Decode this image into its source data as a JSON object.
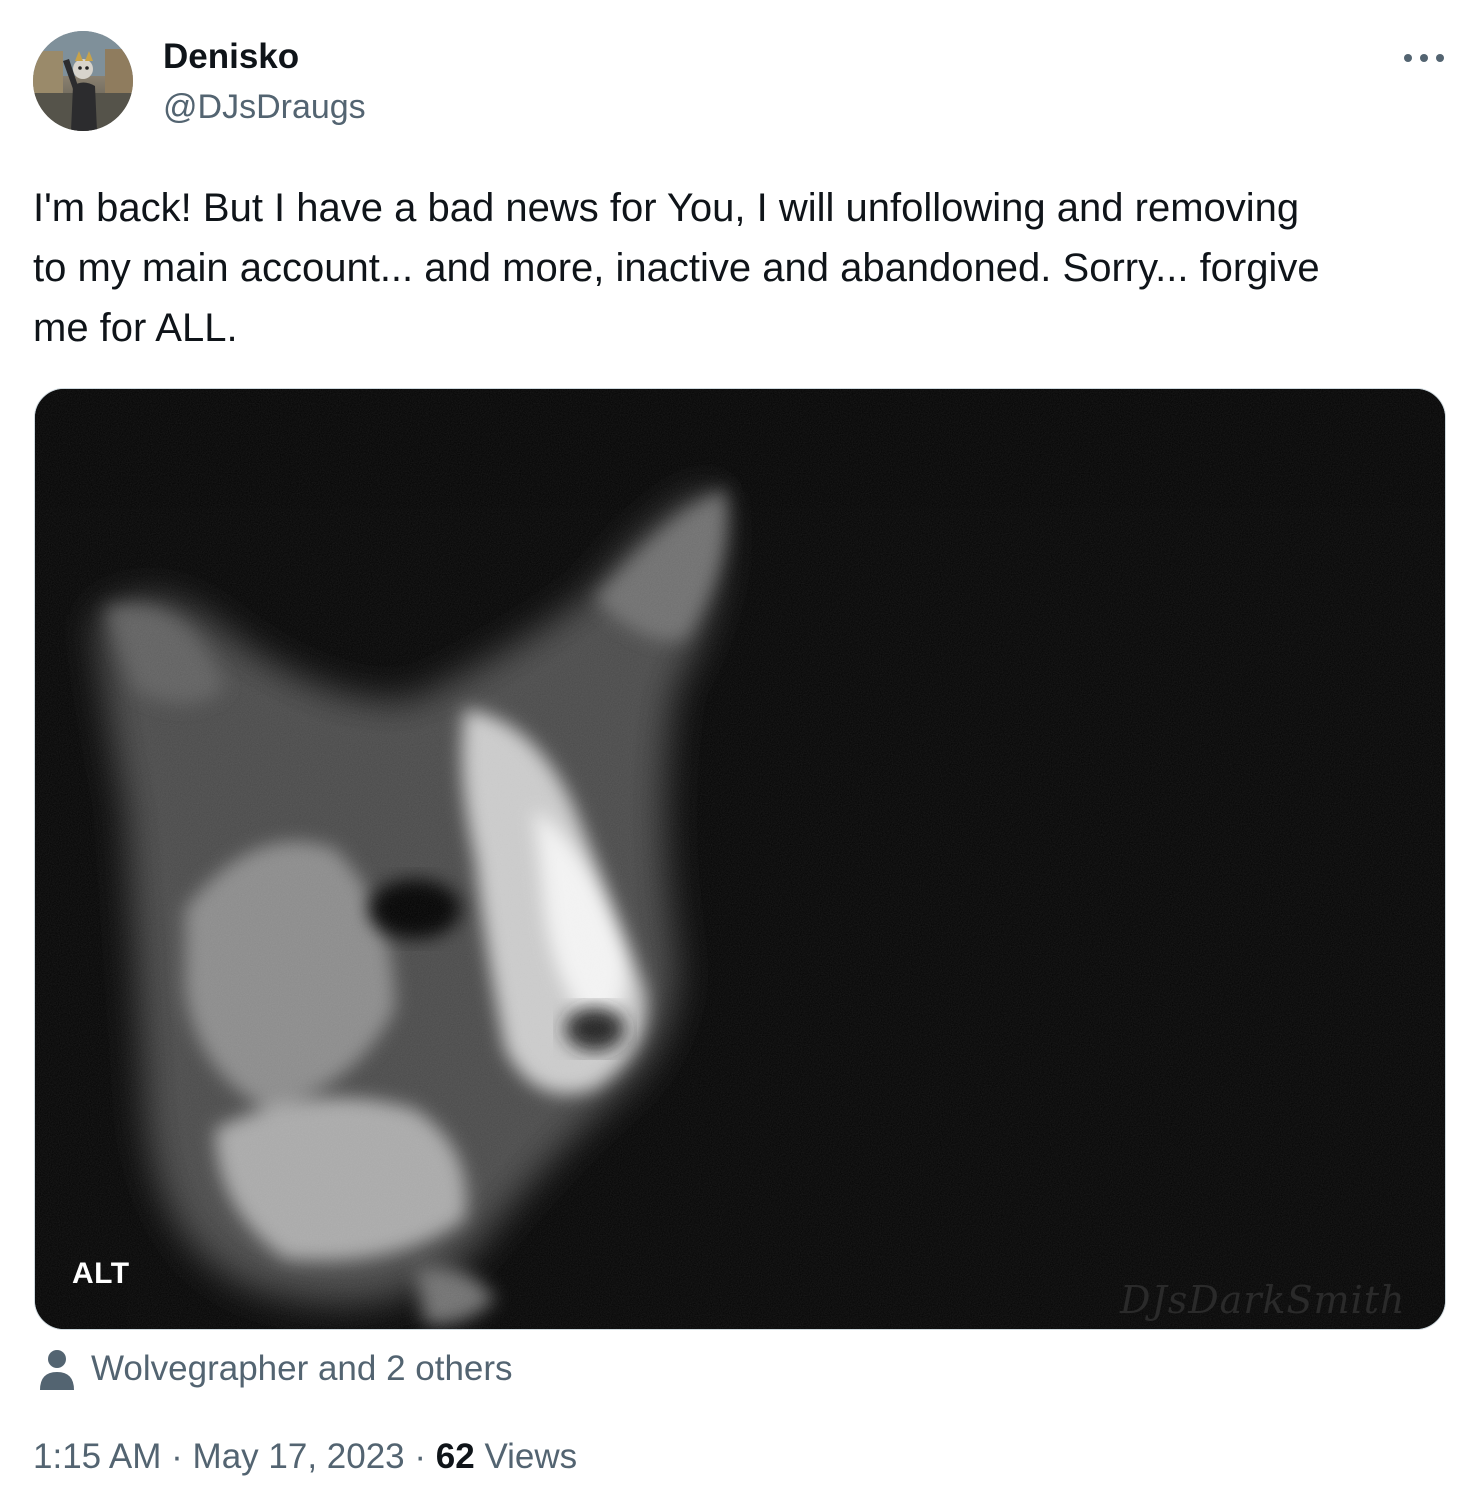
{
  "author": {
    "display_name": "Denisko",
    "handle": "@DJsDraugs"
  },
  "more_icon": "more-horizontal-icon",
  "tweet": {
    "text": "I'm back! But I have a bad news for You, I will unfollowing and removing\nto my main account... and more, inactive and abandoned. Sorry... forgive\nme for ALL."
  },
  "media": {
    "alt_label": "ALT",
    "watermark": "DJsDarkSmith"
  },
  "tagged": {
    "icon": "person-icon",
    "text": "Wolvegrapher and 2 others"
  },
  "meta": {
    "time": "1:15 AM",
    "date": "May 17, 2023",
    "separator": "·",
    "views_count": "62",
    "views_label": "Views"
  },
  "colors": {
    "primary_text": "#0f1419",
    "secondary_text": "#536471",
    "border": "#cfd9de",
    "background": "#ffffff"
  }
}
